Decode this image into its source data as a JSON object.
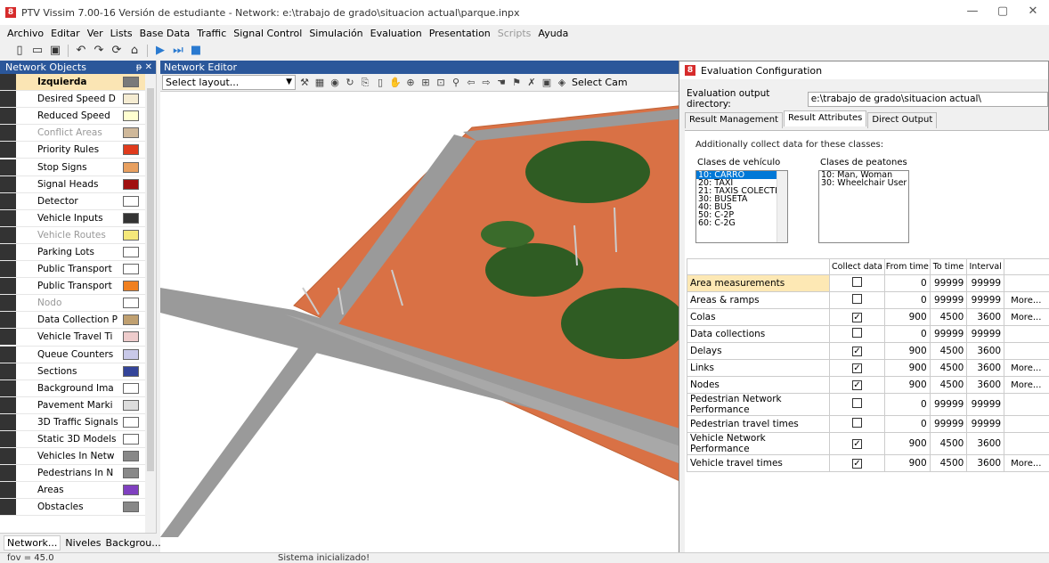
{
  "window": {
    "title": "PTV Vissim 7.00-16 Versión de estudiante - Network: e:\\trabajo de grado\\situacion actual\\parque.inpx",
    "app_icon": "8"
  },
  "window_controls": {
    "minimize": "—",
    "maximize": "▢",
    "close": "✕"
  },
  "menu": [
    "Archivo",
    "Editar",
    "Ver",
    "Lists",
    "Base Data",
    "Traffic",
    "Signal Control",
    "Simulación",
    "Evaluation",
    "Presentation",
    "Scripts",
    "Ayuda"
  ],
  "left_panel": {
    "title": "Network Objects",
    "controls": "ᵽ ✕",
    "items": [
      {
        "label": "Izquierda",
        "icon": "link-icon",
        "swatch": "#7a7a7a",
        "selected": true
      },
      {
        "label": "Desired Speed D",
        "icon": "speed-50-icon",
        "swatch": "#f5ecd2"
      },
      {
        "label": "Reduced Speed",
        "icon": "warning-triangle-icon",
        "swatch": "#ffffd0"
      },
      {
        "label": "Conflict Areas",
        "icon": "conflict-icon",
        "swatch": "#cfb89a",
        "dim": true
      },
      {
        "label": "Priority Rules",
        "icon": "priority-icon",
        "swatch": "#e03a1c"
      },
      {
        "label": "Stop Signs",
        "icon": "stop-icon",
        "swatch": "#e8a060"
      },
      {
        "label": "Signal Heads",
        "icon": "signal-head-icon",
        "swatch": "#a01010"
      },
      {
        "label": "Detector",
        "icon": "detector-icon",
        "swatch": "#ffffff"
      },
      {
        "label": "Vehicle Inputs",
        "icon": "vehicle-input-icon",
        "swatch": "#333333"
      },
      {
        "label": "Vehicle Routes",
        "icon": "route-icon",
        "swatch": "#f5e87a",
        "dim": true
      },
      {
        "label": "Parking Lots",
        "icon": "parking-icon",
        "swatch": "#ffffff"
      },
      {
        "label": "Public Transport",
        "icon": "pt-stop-icon",
        "swatch": "#ffffff"
      },
      {
        "label": "Public Transport",
        "icon": "pt-line-icon",
        "swatch": "#f08020"
      },
      {
        "label": "Nodo",
        "icon": "node-icon",
        "swatch": "#ffffff",
        "dim": true
      },
      {
        "label": "Data Collection P",
        "icon": "data-collection-icon",
        "swatch": "#c0a070"
      },
      {
        "label": "Vehicle Travel Ti",
        "icon": "travel-time-icon",
        "swatch": "#eecccc"
      },
      {
        "label": "Queue Counters",
        "icon": "queue-counter-icon",
        "swatch": "#c8c8e8"
      },
      {
        "label": "Sections",
        "icon": "section-icon",
        "swatch": "#334499"
      },
      {
        "label": "Background Ima",
        "icon": "background-image-icon",
        "swatch": "#ffffff"
      },
      {
        "label": "Pavement Marki",
        "icon": "pavement-icon",
        "swatch": "#dddddd"
      },
      {
        "label": "3D Traffic Signals",
        "icon": "3d-signal-icon",
        "swatch": "#ffffff"
      },
      {
        "label": "Static 3D Models",
        "icon": "static-model-icon",
        "swatch": "#ffffff"
      },
      {
        "label": "Vehicles In Netw",
        "icon": "vehicle-icon",
        "swatch": "#888888"
      },
      {
        "label": "Pedestrians In N",
        "icon": "pedestrian-icon",
        "swatch": "#888888"
      },
      {
        "label": "Areas",
        "icon": "area-icon",
        "swatch": "#8040c0"
      },
      {
        "label": "Obstacles",
        "icon": "obstacle-icon",
        "swatch": "#888888"
      }
    ],
    "tabs": [
      "Network...",
      "Niveles",
      "Backgrou..."
    ]
  },
  "network_editor": {
    "title": "Network Editor",
    "layout_placeholder": "Select layout...",
    "camera_label": "Select Cam"
  },
  "status_bar": {
    "fov": "fov = 45.0",
    "message": "Sistema inicializado!"
  },
  "evaluation": {
    "title": "Evaluation Configuration",
    "dir_label": "Evaluation output directory:",
    "dir_value": "e:\\trabajo de grado\\situacion actual\\",
    "tabs": [
      "Result Management",
      "Result Attributes",
      "Direct Output"
    ],
    "active_tab": "Result Attributes",
    "subtitle": "Additionally collect data for these classes:",
    "vehicle_classes_label": "Clases de vehículo",
    "vehicle_classes": [
      "10: CARRO",
      "20: TAXI",
      "21: TAXIS COLECTI",
      "30: BUSETA",
      "40: BUS",
      "50: C-2P",
      "60: C-2G"
    ],
    "pedestrian_classes_label": "Clases de peatones",
    "pedestrian_classes": [
      "10: Man, Woman",
      "30: Wheelchair User"
    ],
    "columns": [
      "",
      "Collect data",
      "From time",
      "To time",
      "Interval",
      ""
    ],
    "rows": [
      {
        "name": "Area measurements",
        "collect": false,
        "from": "0",
        "to": "99999",
        "interval": "99999",
        "more": ""
      },
      {
        "name": "Areas & ramps",
        "collect": false,
        "from": "0",
        "to": "99999",
        "interval": "99999",
        "more": "More..."
      },
      {
        "name": "Colas",
        "collect": true,
        "from": "900",
        "to": "4500",
        "interval": "3600",
        "more": "More..."
      },
      {
        "name": "Data collections",
        "collect": false,
        "from": "0",
        "to": "99999",
        "interval": "99999",
        "more": ""
      },
      {
        "name": "Delays",
        "collect": true,
        "from": "900",
        "to": "4500",
        "interval": "3600",
        "more": ""
      },
      {
        "name": "Links",
        "collect": true,
        "from": "900",
        "to": "4500",
        "interval": "3600",
        "more": "More..."
      },
      {
        "name": "Nodes",
        "collect": true,
        "from": "900",
        "to": "4500",
        "interval": "3600",
        "more": "More..."
      },
      {
        "name": "Pedestrian Network Performance",
        "collect": false,
        "from": "0",
        "to": "99999",
        "interval": "99999",
        "more": ""
      },
      {
        "name": "Pedestrian travel times",
        "collect": false,
        "from": "0",
        "to": "99999",
        "interval": "99999",
        "more": ""
      },
      {
        "name": "Vehicle Network Performance",
        "collect": true,
        "from": "900",
        "to": "4500",
        "interval": "3600",
        "more": ""
      },
      {
        "name": "Vehicle travel times",
        "collect": true,
        "from": "900",
        "to": "4500",
        "interval": "3600",
        "more": "More..."
      }
    ]
  }
}
